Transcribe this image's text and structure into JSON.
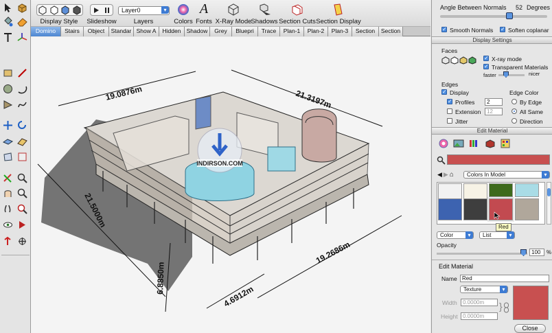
{
  "toolbar": {
    "display_style": "Display Style",
    "slideshow": "Slideshow",
    "layer_value": "Layer0",
    "layers": "Layers",
    "colors": "Colors",
    "fonts": "Fonts",
    "xray": "X-Ray Mode",
    "shadows": "Shadows",
    "section_cuts": "Section Cuts",
    "section_display": "Section Display",
    "fonts_glyph": "A"
  },
  "scene_tabs": [
    "Domino",
    "Stairs",
    "Object",
    "Standar",
    "Show A",
    "Hidden",
    "Shadow",
    "Grey",
    "Bluepri",
    "Trace",
    "Plan-1",
    "Plan-2",
    "Plan-3",
    "Section",
    "Section"
  ],
  "viewport": {
    "dimensions": [
      "19.0876m",
      "21.3197m",
      "21.5000m",
      "19.2686m",
      "4.6912m",
      "6.8850m"
    ],
    "watermark": "INDIRSON.COM"
  },
  "panel": {
    "angle_label": "Angle Between Normals",
    "angle_value": "52",
    "angle_unit": "Degrees",
    "smooth_normals": "Smooth Normals",
    "soften_coplanar": "Soften coplanar",
    "display_settings_title": "Display Settings",
    "faces": "Faces",
    "xray_mode": "X-ray mode",
    "transparent_materials": "Transparent Materials",
    "faster": "faster",
    "nicer": "nicer",
    "edges": "Edges",
    "display": "Display",
    "edge_color": "Edge Color",
    "profiles": "Profiles",
    "profiles_value": "2",
    "by_edge": "By Edge",
    "extension": "Extension",
    "extension_value": "12",
    "all_same": "All Same",
    "jitter": "Jitter",
    "direction": "Direction",
    "edit_material_title": "Edit Material",
    "colors_in_model": "Colors In Model",
    "tooltip": "Red",
    "color_select": "Color",
    "list_select": "List",
    "opacity": "Opacity",
    "opacity_value": "100",
    "opacity_unit": "%",
    "edit_material": "Edit Material",
    "name_label": "Name",
    "name_value": "Red",
    "texture": "Texture",
    "width_label": "Width",
    "width_value": "0.0000m",
    "height_label": "Height",
    "height_value": "0.0000m",
    "close": "Close"
  },
  "colors": {
    "selected_material": "#c85050",
    "swatches": [
      "#f2f2f2",
      "#f7f3e6",
      "#3d6a1c",
      "#a9dce6",
      "#3d63b0",
      "#3e3e3e",
      "#c24a50",
      "#b0a79b"
    ]
  },
  "icons": [
    "select-icon",
    "make-component-icon",
    "paint-bucket-icon",
    "eraser-icon",
    "text-icon",
    "axes-icon",
    "rectangle-icon",
    "line-icon",
    "circle-icon",
    "arc-icon",
    "polygon-icon",
    "freehand-icon",
    "move-icon",
    "rotate-icon",
    "push-pull-icon",
    "follow-me-icon",
    "offset-icon",
    "scale-icon",
    "tape-measure-icon",
    "dimension-icon",
    "orbit-icon",
    "zoom-icon",
    "pan-icon",
    "zoom-window-icon",
    "walk-icon",
    "position-camera-icon",
    "look-around-icon",
    "section-plane-icon",
    "pencil-icon",
    "compass-icon"
  ]
}
